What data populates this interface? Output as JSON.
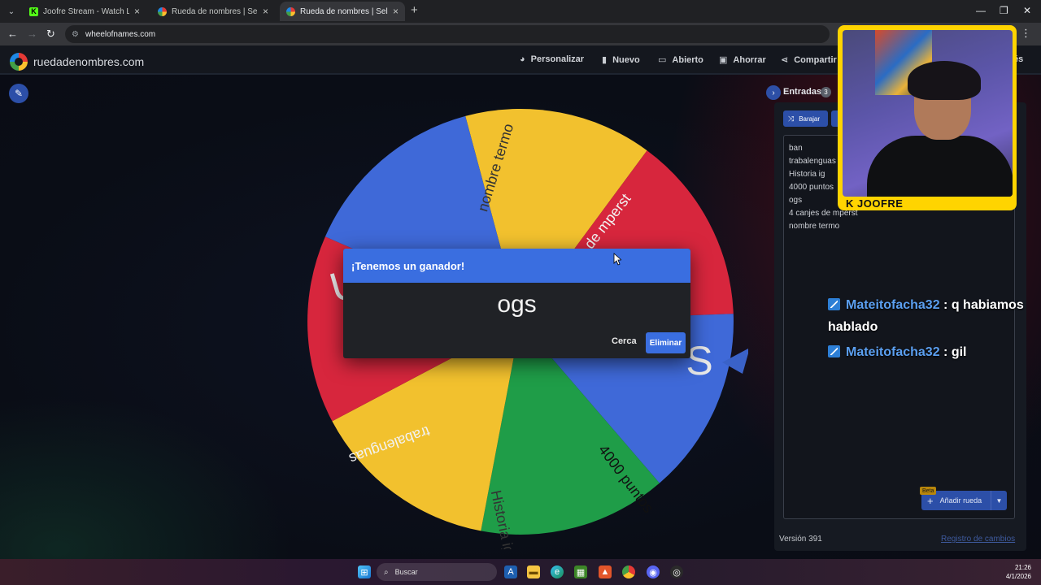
{
  "browser": {
    "tabs": [
      {
        "title": "Joofre Stream - Watch Live on Kick",
        "favicon": "kick-icon",
        "active": false
      },
      {
        "title": "Rueda de nombres | Selector de nombres",
        "favicon": "wheel-icon",
        "active": false
      },
      {
        "title": "Rueda de nombres | Selector de nombres",
        "favicon": "wheel-icon",
        "active": true
      }
    ],
    "url": "wheelofnames.com"
  },
  "app": {
    "brand": "ruedadenombres.com",
    "menu": [
      {
        "label": "Personalizar",
        "icon": "palette-icon"
      },
      {
        "label": "Nuevo",
        "icon": "file-icon"
      },
      {
        "label": "Abierto",
        "icon": "folder-icon"
      },
      {
        "label": "Ahorrar",
        "icon": "save-icon"
      },
      {
        "label": "Compartir",
        "icon": "share-icon"
      }
    ],
    "menu_more_fragment": "és"
  },
  "wheel": {
    "segments": [
      {
        "label": "nombre termo",
        "color": "#f2c12e"
      },
      {
        "label": "4 canjes de mperst",
        "color": "#d7263d"
      },
      {
        "label": "ogs",
        "color": "#3f69d8"
      },
      {
        "label": "4000 puntos",
        "color": "#1f9d48"
      },
      {
        "label": "Historia ig",
        "color": "#f2c12e"
      },
      {
        "label": "trabalenguas",
        "color": "#d7263d"
      },
      {
        "label": "ban",
        "color": "#3f69d8"
      }
    ],
    "visible_labels": {
      "nombre_termo": "nombre termo",
      "mperst": "njes de mperst",
      "puntos": "4000 puntos",
      "historia": "Historia ig",
      "trabalenguas": "trabalenguas",
      "ban_fragment": "U",
      "ogs_fragment": "S"
    },
    "pointer_color": "#3a62c8"
  },
  "panel": {
    "tab_label": "Entradas",
    "count": "3",
    "shuffle_label": "Barajar",
    "entries": [
      "ban",
      "trabalenguas",
      "Historia ig",
      "4000 puntos",
      "ogs",
      "4 canjes de mperst",
      "nombre termo"
    ],
    "beta_label": "Beta",
    "add_wheel_label": "Añadir rueda",
    "version": "Versión 391",
    "changelog": "Registro de cambios"
  },
  "dialog": {
    "title": "¡Tenemos un ganador!",
    "winner": "ogs",
    "close_label": "Cerca",
    "remove_label": "Eliminar"
  },
  "chat": [
    {
      "user": "Mateitofacha32",
      "message_line1": ": q habiamos",
      "message_line2": "hablado"
    },
    {
      "user": "Mateitofacha32",
      "message_line1": ": gil"
    }
  ],
  "webcam": {
    "label": "K JOOFRE"
  },
  "taskbar": {
    "search_placeholder": "Buscar",
    "time": "21:26",
    "date": "4/1/2026"
  }
}
